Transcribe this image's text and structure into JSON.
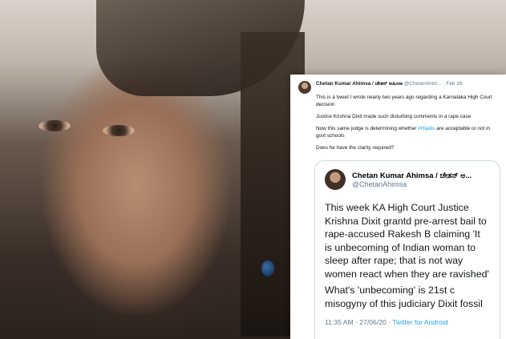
{
  "tweet": {
    "author_name": "Chetan Kumar Ahimsa / ಚೇತನ್ ಅಹಿಂಸಾ",
    "author_handle": "@ChetanAhim...",
    "date": "Feb 16",
    "line1": "This is a tweet I wrote nearly two years ago regarding a Karnataka High Court decision",
    "line2": "Justice Krishna Dixit made such disturbing comments in a rape case",
    "line3_pre": "Now this same judge is determining whether ",
    "line3_tag": "#Hijabs",
    "line3_post": " are acceptable or not in govt schools",
    "line4": "Does he have the clarity required?"
  },
  "quoted": {
    "author_name": "Chetan Kumar Ahimsa / ಚೇತನ್ ಅ...",
    "author_handle": "@ChetanAhimsa",
    "text1": "This week KA High Court Justice Krishna Dixit grantd pre-arrest bail to rape-accused Rakesh B claiming 'It is unbecoming of Indian woman to sleep after rape; that is not way women react when they are ravished'",
    "text2": "What's 'unbecoming' is 21st c misogyny of this judiciary Dixit fossil",
    "timestamp": "11:35 AM · 27/06/20 · ",
    "source": "Twitter for Android"
  }
}
